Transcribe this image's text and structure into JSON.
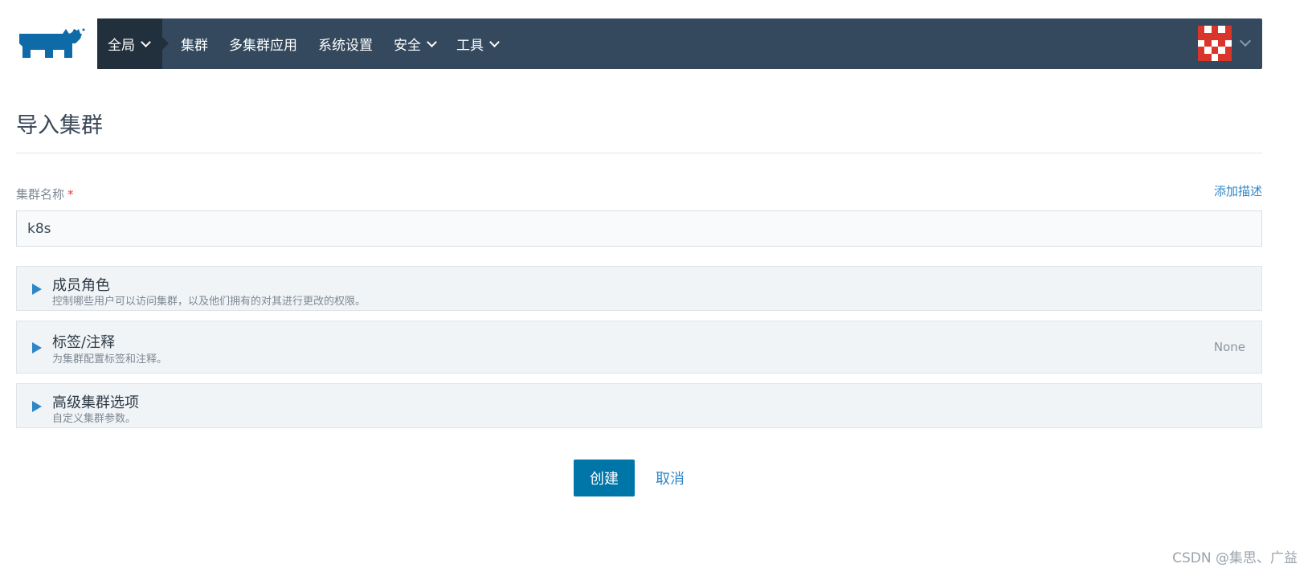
{
  "nav": {
    "logo_icon": "rancher-logo-icon",
    "items": [
      {
        "label": "全局",
        "dropdown": true
      },
      {
        "label": "集群",
        "dropdown": false
      },
      {
        "label": "多集群应用",
        "dropdown": false
      },
      {
        "label": "系统设置",
        "dropdown": false
      },
      {
        "label": "安全",
        "dropdown": true
      },
      {
        "label": "工具",
        "dropdown": true
      }
    ],
    "avatar_icon": "user-avatar-identicon",
    "colors": {
      "bar": "#34495e",
      "active": "#22303d",
      "accent": "#2f86c7",
      "primary_button": "#0075a8"
    }
  },
  "page": {
    "title": "导入集群"
  },
  "form": {
    "name_label": "集群名称",
    "required_mark": "*",
    "add_description": "添加描述",
    "name_value": "k8s"
  },
  "sections": [
    {
      "title": "成员角色",
      "subtitle": "控制哪些用户可以访问集群，以及他们拥有的对其进行更改的权限。",
      "right": ""
    },
    {
      "title": "标签/注释",
      "subtitle": "为集群配置标签和注释。",
      "right": "None"
    },
    {
      "title": "高级集群选项",
      "subtitle": "自定义集群参数。",
      "right": ""
    }
  ],
  "actions": {
    "create": "创建",
    "cancel": "取消"
  },
  "watermark": "CSDN @集思、广益"
}
